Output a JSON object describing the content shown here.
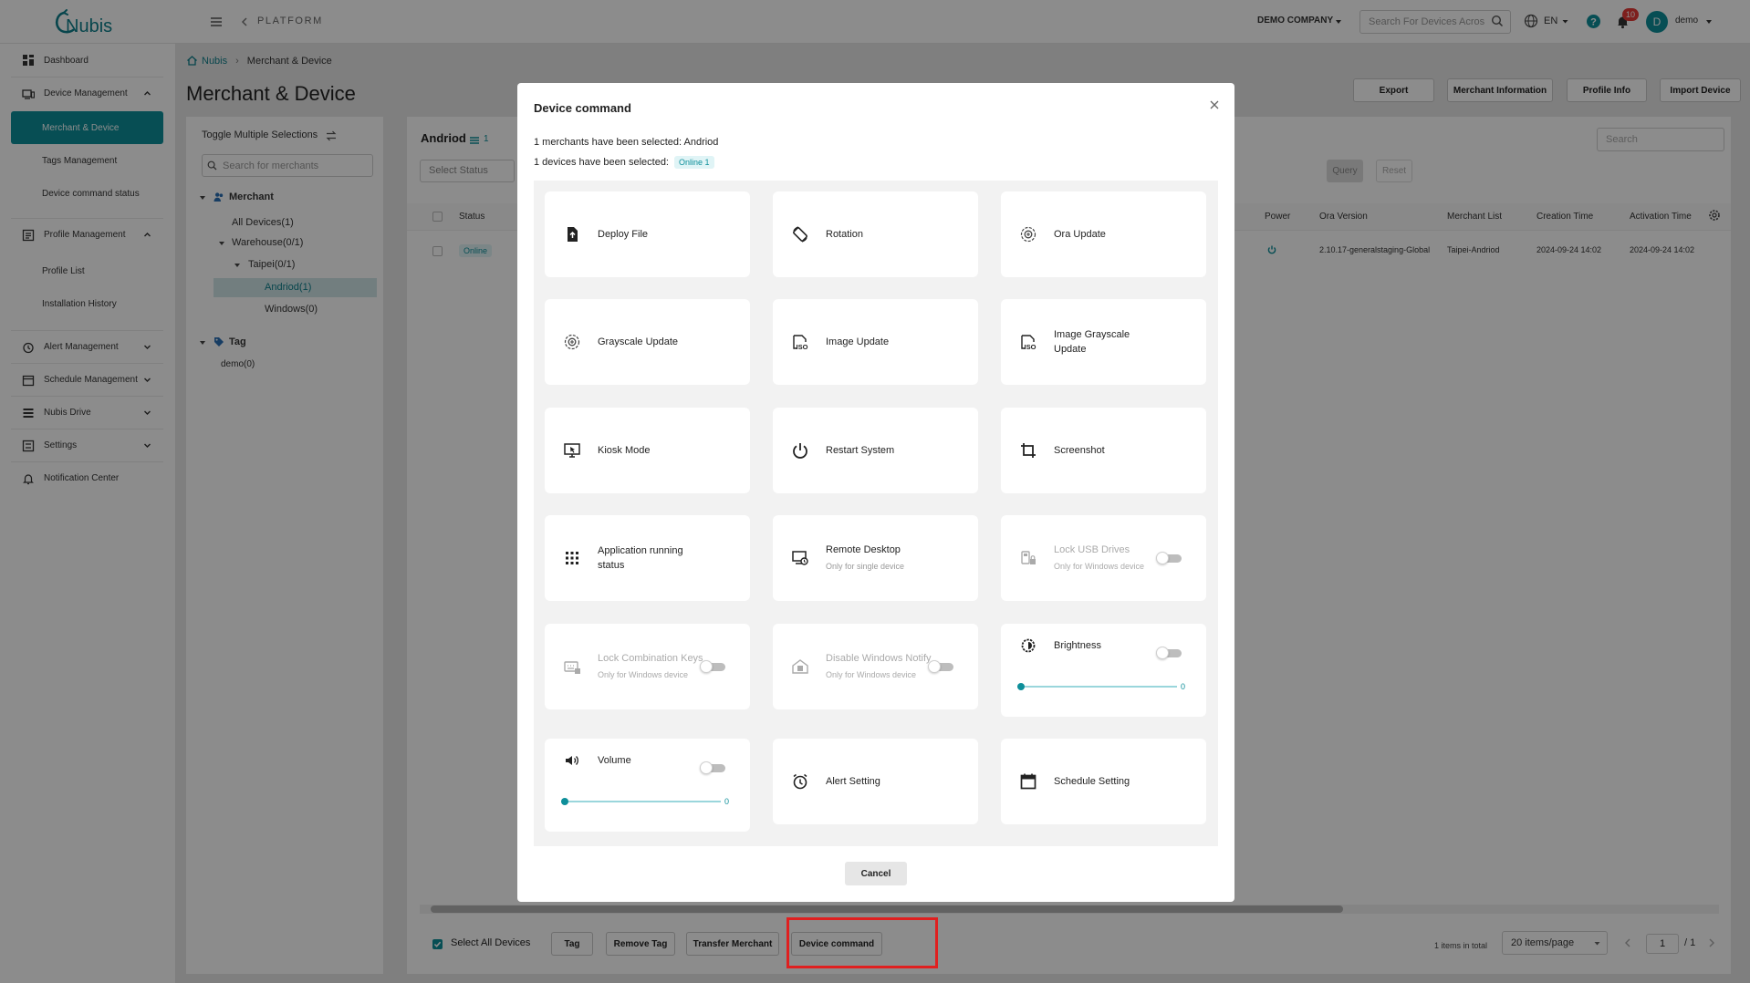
{
  "app": {
    "logo_text": "Nubis",
    "platform_label": "PLATFORM",
    "company": "DEMO COMPANY",
    "search_placeholder": "Search For Devices Across",
    "language": "EN",
    "notification_count": "10",
    "user_initial": "D",
    "user_name": "demo"
  },
  "sidebar": {
    "dashboard": "Dashboard",
    "device_management": "Device Management",
    "merchant_device": "Merchant & Device",
    "tags_management": "Tags Management",
    "device_command_status": "Device command status",
    "profile_management": "Profile Management",
    "profile_list": "Profile List",
    "installation_history": "Installation History",
    "alert_management": "Alert Management",
    "schedule_management": "Schedule Management",
    "nubis_drive": "Nubis Drive",
    "settings": "Settings",
    "notification_center": "Notification Center"
  },
  "breadcrumb": {
    "root": "Nubis",
    "current": "Merchant & Device"
  },
  "page_title": "Merchant & Device",
  "actions": {
    "export": "Export",
    "merchant_information": "Merchant Information",
    "profile_info": "Profile Info",
    "import_device": "Import Device"
  },
  "tree": {
    "toggle_label": "Toggle Multiple Selections",
    "search_placeholder": "Search for merchants",
    "merchant_header": "Merchant",
    "all_devices": "All Devices(1)",
    "warehouse": "Warehouse(0/1)",
    "taipei": "Taipei(0/1)",
    "andriod": "Andriod(1)",
    "windows": "Windows(0)",
    "tag_header": "Tag",
    "demo_tag": "demo(0)"
  },
  "list": {
    "title": "Andriod",
    "count": "1",
    "status_placeholder": "Select Status",
    "search_placeholder": "Search",
    "query": "Query",
    "reset": "Reset",
    "columns": [
      "Status",
      "Power",
      "Ora Version",
      "Merchant List",
      "Creation Time",
      "Activation Time"
    ],
    "row": {
      "status": "Online",
      "ora_version": "2.10.17-generalstaging-Global",
      "merchant": "Taipei-Andriod",
      "creation_time": "2024-09-24 14:02",
      "activation_time": "2024-09-24 14:02"
    }
  },
  "bottom": {
    "select_all": "Select All Devices",
    "tag": "Tag",
    "remove_tag": "Remove Tag",
    "transfer_merchant": "Transfer Merchant",
    "device_command": "Device command",
    "total": "1 items in total",
    "page_size": "20 items/page",
    "page": "1",
    "page_total": "/ 1"
  },
  "modal": {
    "title": "Device command",
    "merchants_selected": "1 merchants have been selected:  Andriod",
    "devices_selected": "1 devices have been selected:",
    "online_badge": "Online 1",
    "cards": {
      "deploy_file": "Deploy File",
      "rotation": "Rotation",
      "ora_update": "Ora Update",
      "grayscale_update": "Grayscale Update",
      "image_update": "Image Update",
      "image_grayscale_update": "Image Grayscale Update",
      "kiosk_mode": "Kiosk Mode",
      "restart_system": "Restart System",
      "screenshot": "Screenshot",
      "app_running_status": "Application running status",
      "remote_desktop": "Remote Desktop",
      "remote_desktop_sub": "Only for single device",
      "lock_usb": "Lock USB Drives",
      "lock_usb_sub": "Only for Windows device",
      "lock_combo": "Lock Combination Keys",
      "lock_combo_sub": "Only for Windows device",
      "disable_notify": "Disable Windows Notify",
      "disable_notify_sub": "Only for Windows device",
      "brightness": "Brightness",
      "brightness_value": "0",
      "volume": "Volume",
      "volume_value": "0",
      "alert_setting": "Alert Setting",
      "schedule_setting": "Schedule Setting"
    },
    "cancel": "Cancel"
  },
  "colors": {
    "accent": "#0e8f9a",
    "highlight": "#e02020"
  }
}
